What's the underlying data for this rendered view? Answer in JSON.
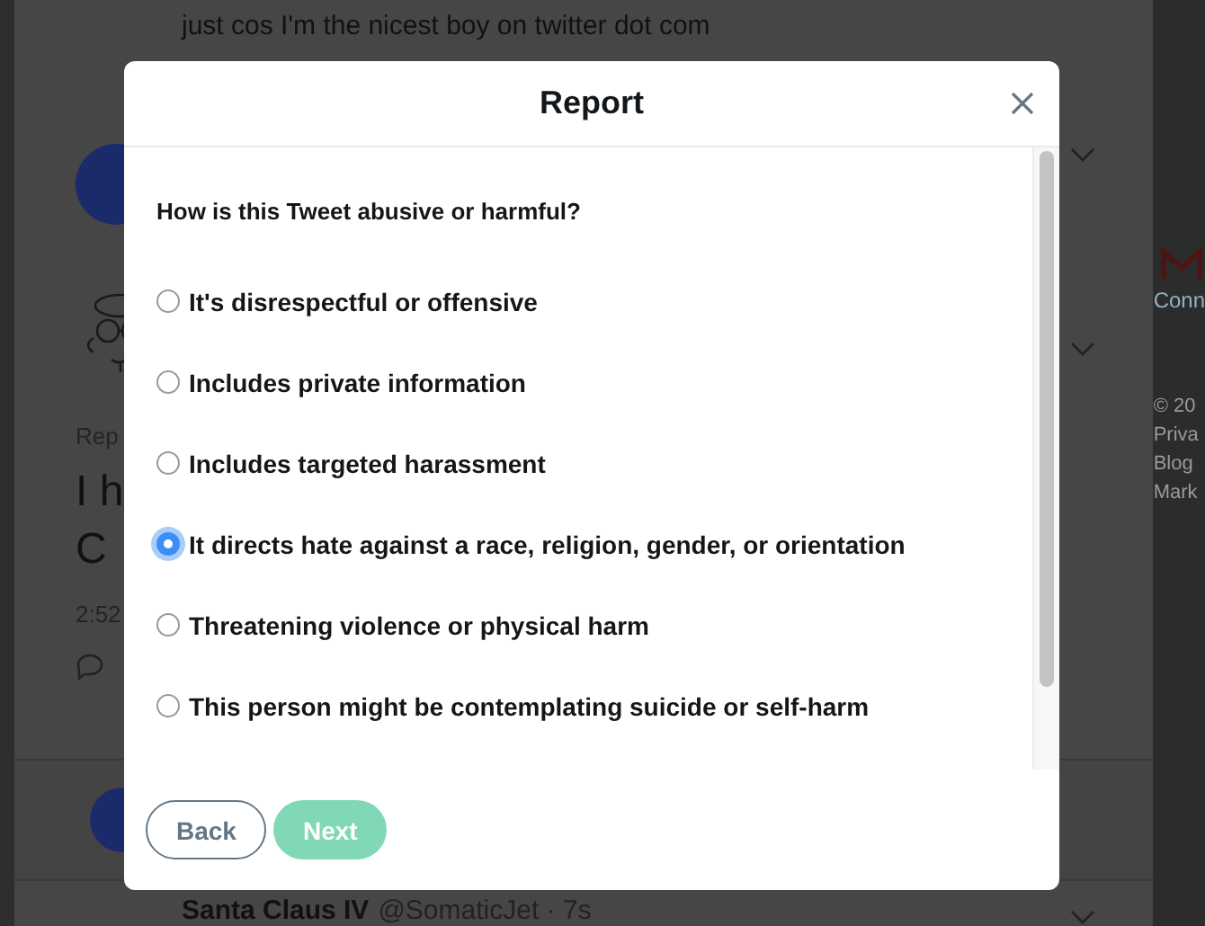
{
  "feed": {
    "top_tweet_text": "just cos I'm the nicest boy on twitter dot com",
    "thread": {
      "context": "Rep",
      "text_lines": [
        "I h",
        "C"
      ],
      "time": "2:52"
    },
    "bottom_tweet": {
      "name": "Santa Claus IV",
      "handle": "@SomaticJet · 7s"
    }
  },
  "sidebar": {
    "link": "Conn",
    "footer_lines": [
      "© 20",
      "Priva",
      "Blog",
      "Mark"
    ]
  },
  "report_dialog": {
    "title": "Report",
    "question": "How is this Tweet abusive or harmful?",
    "options": [
      {
        "label": "It's disrespectful or offensive",
        "selected": false
      },
      {
        "label": "Includes private information",
        "selected": false
      },
      {
        "label": "Includes targeted harassment",
        "selected": false
      },
      {
        "label": "It directs hate against a race, religion, gender, or orientation",
        "selected": true
      },
      {
        "label": "Threatening violence or physical harm",
        "selected": false
      },
      {
        "label": "This person might be contemplating suicide or self-harm",
        "selected": false
      }
    ],
    "buttons": [
      {
        "label": "Back",
        "kind": "secondary",
        "disabled": false
      },
      {
        "label": "Next",
        "kind": "primary",
        "disabled": true
      }
    ]
  }
}
